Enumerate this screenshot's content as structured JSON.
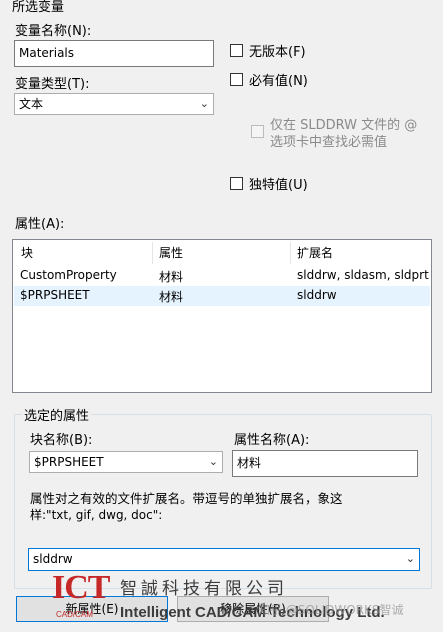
{
  "selected_variable": {
    "section_title": "所选变量",
    "variable_name_label": "变量名称(N):",
    "variable_name_value": "Materials",
    "variable_type_label": "变量类型(T):",
    "variable_type_value": "文本",
    "no_version_label": "无版本(F)",
    "required_label": "必有值(N)",
    "slddrw_only_line1": "仅在 SLDDRW 文件的 @",
    "slddrw_only_line2": "选项卡中查找必需值",
    "unique_label": "独特值(U)"
  },
  "properties": {
    "label": "属性(A):",
    "columns": [
      "块",
      "属性",
      "扩展名"
    ],
    "rows": [
      {
        "block": "CustomProperty",
        "property": "材料",
        "ext": "slddrw, sldasm, sldprt"
      },
      {
        "block": "$PRPSHEET",
        "property": "材料",
        "ext": "slddrw"
      }
    ]
  },
  "selected_property": {
    "group_title": "选定的属性",
    "block_name_label": "块名称(B):",
    "block_name_value": "$PRPSHEET",
    "property_name_label": "属性名称(A):",
    "property_name_value": "材料",
    "ext_hint_line1": "属性对之有效的文件扩展名。带逗号的单独扩展名，象这",
    "ext_hint_line2": "样:\"txt, gif, dwg, doc\":",
    "ext_value": "slddrw"
  },
  "buttons": {
    "new_property": "新属性(E)",
    "remove_property": "移除属性(R)"
  },
  "overlay": {
    "logo": "ICT",
    "logo_sub": "CAD/CAM",
    "company_zh": "智誠科技有限公司",
    "company_en": "Intelligent CAD/CAM Technology Ltd.",
    "watermark": "知乎 @SOLIDWORKS智诚"
  }
}
